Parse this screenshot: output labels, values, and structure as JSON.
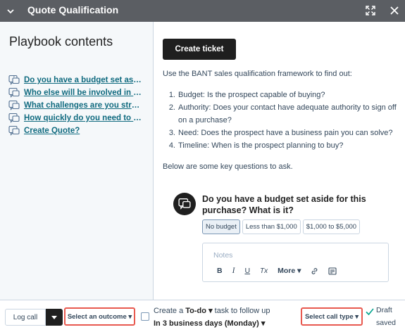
{
  "header": {
    "title": "Quote Qualification",
    "icons": {
      "collapse": "chevron-down-icon",
      "expand": "expand-icon",
      "close": "close-icon"
    }
  },
  "sidebar": {
    "title": "Playbook contents",
    "items": [
      {
        "label": "Do you have a budget set aside for this purchase? What is it?"
      },
      {
        "label": "Who else will be involved in the purchase decision?"
      },
      {
        "label": "What challenges are you struggling with?"
      },
      {
        "label": "How quickly do you need to solve this?"
      },
      {
        "label": "Create Quote?"
      }
    ]
  },
  "main": {
    "create_ticket_label": "Create ticket",
    "intro": "Use the BANT sales qualification framework to find out:",
    "bant": [
      {
        "num": "1.",
        "text": "Budget: Is the prospect capable of buying?"
      },
      {
        "num": "2.",
        "text": "Authority: Does your contact have adequate authority to sign off on a purchase?"
      },
      {
        "num": "3.",
        "text": "Need: Does the prospect have a business pain you can solve?"
      },
      {
        "num": "4.",
        "text": "Timeline: When is the prospect planning to buy?"
      }
    ],
    "below_text": "Below are some key questions to ask.",
    "question": {
      "text": "Do you have a budget set aside for this purchase? What is it?",
      "options": [
        "No budget",
        "Less than $1,000",
        "$1,000 to $5,000"
      ],
      "selected": "No budget",
      "notes_placeholder": "Notes",
      "toolbar": {
        "bold": "B",
        "italic": "I",
        "underline": "U",
        "clear": "Tx",
        "more": "More"
      }
    }
  },
  "bottom": {
    "log_call_label": "Log call",
    "outcome_label": "Select an outcome",
    "todo_prefix": "Create a",
    "todo_type": "To-do",
    "todo_suffix": "task to follow up",
    "todo_due": "In 3 business days (Monday)",
    "call_type_label": "Select call type",
    "draft_line1": "Draft",
    "draft_line2": "saved"
  },
  "colors": {
    "header_bg": "#5b5e63",
    "link": "#0f6a7f",
    "highlight_border": "#e8594f",
    "dark_button": "#1f1f1f"
  }
}
